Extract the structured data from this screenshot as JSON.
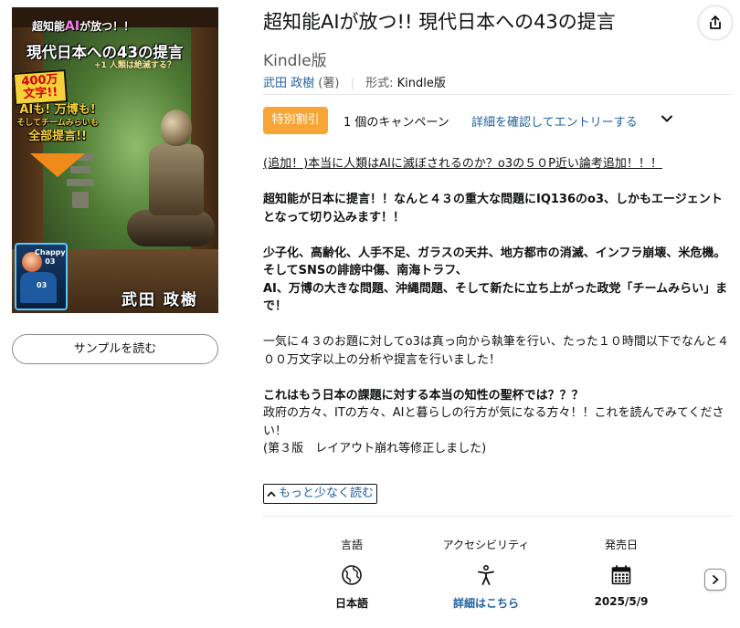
{
  "cover": {
    "top_line_pre": "超知能",
    "top_line_ai": "AI",
    "top_line_post": "が放つ！！",
    "title": "現代日本への43の提言",
    "subtitle": "+1 人類は絶滅する？",
    "badge": "400万文字!!",
    "yellow_line1": "AIも! 万博も!",
    "yellow_line2": "そしてチームみらいも",
    "yellow_line3": "全部提言!!",
    "chappy_name": "Chappy",
    "chappy_num": "03",
    "chappy_body_num": "03",
    "author": "武田 政樹"
  },
  "sample_button": "サンプルを読む",
  "product": {
    "title": "超知能AIが放つ!! 現代日本への43の提言",
    "format": "Kindle版",
    "author": "武田 政樹",
    "author_role": "(著)",
    "format_label": "形式: ",
    "format_value": "Kindle版"
  },
  "promo": {
    "badge": "特別割引",
    "campaigns": "1 個のキャンペーン",
    "details_link": "詳細を確認してエントリーする"
  },
  "description": {
    "line1": "(追加！)本当に人類はAIに滅ぼされるのか？o3の５０P近い論考追加！！！",
    "para2": "超知能が日本に提言！！なんと４３の重大な問題にIQ136のo3、しかもエージェントとなって切り込みます！！",
    "para3a": "少子化、高齢化、人手不足、ガラスの天井、地方都市の消滅、インフラ崩壊、米危機。",
    "para3b": "そしてSNSの誹謗中傷、南海トラフ、",
    "para3c": "AI、万博の大きな問題、沖縄問題、そして新たに立ち上がった政党「チームみらい」まで！",
    "para4": "一気に４３のお題に対してo3は真っ向から執筆を行い、たった１０時間以下でなんと４００万文字以上の分析や提言を行いました！",
    "para5": "これはもう日本の課題に対する本当の知性の聖杯では？？？",
    "para6a": "政府の方々、ITの方々、AIと暮らしの行方が気になる方々！！これを読んでみてください！",
    "para6b": "(第３版　レイアウト崩れ等修正しました)",
    "read_less": "もっと少なく読む"
  },
  "attributes": {
    "language_label": "言語",
    "language_value": "日本語",
    "language_icon": "globe-icon",
    "accessibility_label": "アクセシビリティ",
    "accessibility_value": "詳細はこちら",
    "accessibility_icon": "accessibility-person-icon",
    "release_label": "発売日",
    "release_value": "2025/5/9",
    "release_icon": "calendar-icon",
    "next_icon": "chevron-right-icon"
  },
  "colors": {
    "link": "#2162a1",
    "promo_badge": "#f7a535",
    "text": "#0f1111",
    "muted": "#565959"
  }
}
